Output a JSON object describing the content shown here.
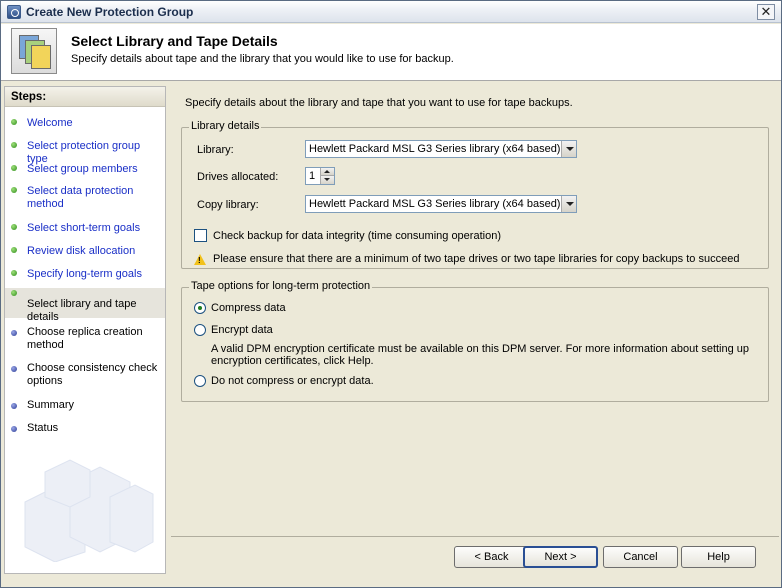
{
  "window": {
    "title": "Create New Protection Group"
  },
  "header": {
    "title": "Select Library and Tape Details",
    "subtitle": "Specify details about tape and the library that you would like to use for backup."
  },
  "steps": {
    "heading": "Steps:",
    "items": [
      {
        "label": "Welcome",
        "state": "done"
      },
      {
        "label": "Select protection group type",
        "state": "done"
      },
      {
        "label": "Select group members",
        "state": "done"
      },
      {
        "label": "Select data protection method",
        "state": "done"
      },
      {
        "label": "Select short-term goals",
        "state": "done"
      },
      {
        "label": "Review disk allocation",
        "state": "done"
      },
      {
        "label": "Specify long-term goals",
        "state": "done"
      },
      {
        "label": "Select library and tape details",
        "state": "current"
      },
      {
        "label": "Choose replica creation method",
        "state": "todo"
      },
      {
        "label": "Choose consistency check options",
        "state": "todo"
      },
      {
        "label": "Summary",
        "state": "todo"
      },
      {
        "label": "Status",
        "state": "todo"
      }
    ]
  },
  "main": {
    "intro": "Specify details about the library and tape that you want to use for tape backups.",
    "library_details": {
      "legend": "Library details",
      "library_label": "Library:",
      "library_value": "Hewlett Packard MSL G3 Series library  (x64 based)",
      "drives_label": "Drives allocated:",
      "drives_value": "1",
      "copy_library_label": "Copy library:",
      "copy_library_value": "Hewlett Packard MSL G3 Series library  (x64 based)",
      "check_backup_label": "Check backup for data integrity (time consuming operation)",
      "check_backup_checked": false,
      "warning": "Please ensure that there are a minimum of two tape drives or two tape libraries for copy backups to succeed"
    },
    "tape_options": {
      "legend": "Tape options for long-term protection",
      "compress_label": "Compress data",
      "encrypt_label": "Encrypt data",
      "encrypt_note_line1": "A valid DPM encryption certificate must be available on this DPM server. For more information about setting up",
      "encrypt_note_line2": "encryption certificates, click Help.",
      "none_label": "Do not compress or encrypt data.",
      "selected": "compress"
    }
  },
  "buttons": {
    "back": "< Back",
    "next": "Next >",
    "cancel": "Cancel",
    "help": "Help"
  },
  "colors": {
    "link": "#1a2fc7",
    "done_dot": "#2f8c1b",
    "todo_dot": "#2a3b95",
    "dialog_bg": "#ece9d8"
  }
}
